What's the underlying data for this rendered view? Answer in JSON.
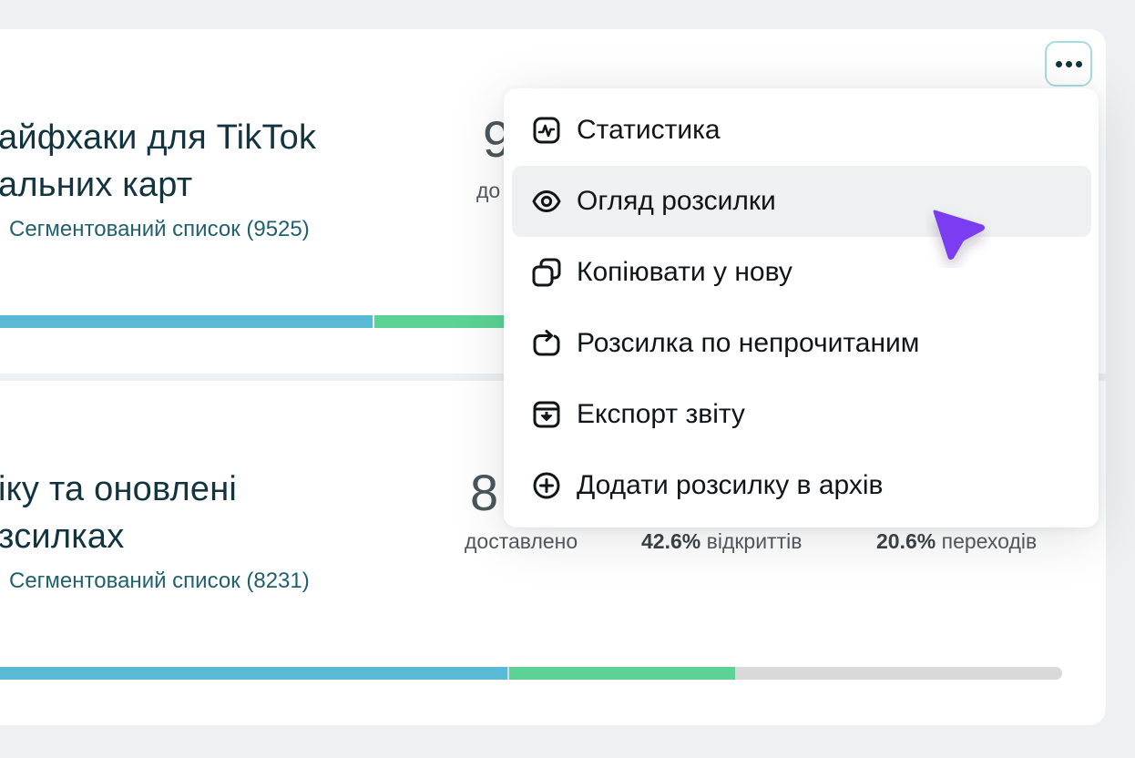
{
  "campaigns": [
    {
      "title_line1": "айфхаки для TikTok",
      "title_line2": "альних карт",
      "segment": "Сегментований список (9525)",
      "delivered_number_partial": "9",
      "delivered_label_partial": "до"
    },
    {
      "title_line1": "іку та оновлені",
      "title_line2": "зсилках",
      "segment": "Сегментований список (8231)",
      "delivered_number_partial": "8",
      "delivered_label": "доставлено",
      "opens_value": "42.6%",
      "opens_label": "відкриттів",
      "clicks_value": "20.6%",
      "clicks_label": "переходів"
    }
  ],
  "menu": {
    "items": [
      {
        "label": "Статистика",
        "icon": "chart-line-icon"
      },
      {
        "label": "Огляд розсилки",
        "icon": "eye-icon"
      },
      {
        "label": "Копіювати у нову",
        "icon": "copy-icon"
      },
      {
        "label": "Розсилка по непрочитаним",
        "icon": "refresh-icon"
      },
      {
        "label": "Експорт звіту",
        "icon": "download-box-icon"
      },
      {
        "label": "Додати розсилку в архів",
        "icon": "plus-circle-icon"
      }
    ],
    "hovered_index": 1
  },
  "colors": {
    "bar_blue": "#5ab9d4",
    "bar_green": "#5cd394",
    "bar_gray": "#d9d9d9",
    "title": "#12343f",
    "segment": "#21606d",
    "cursor": "#7a3cf0"
  }
}
